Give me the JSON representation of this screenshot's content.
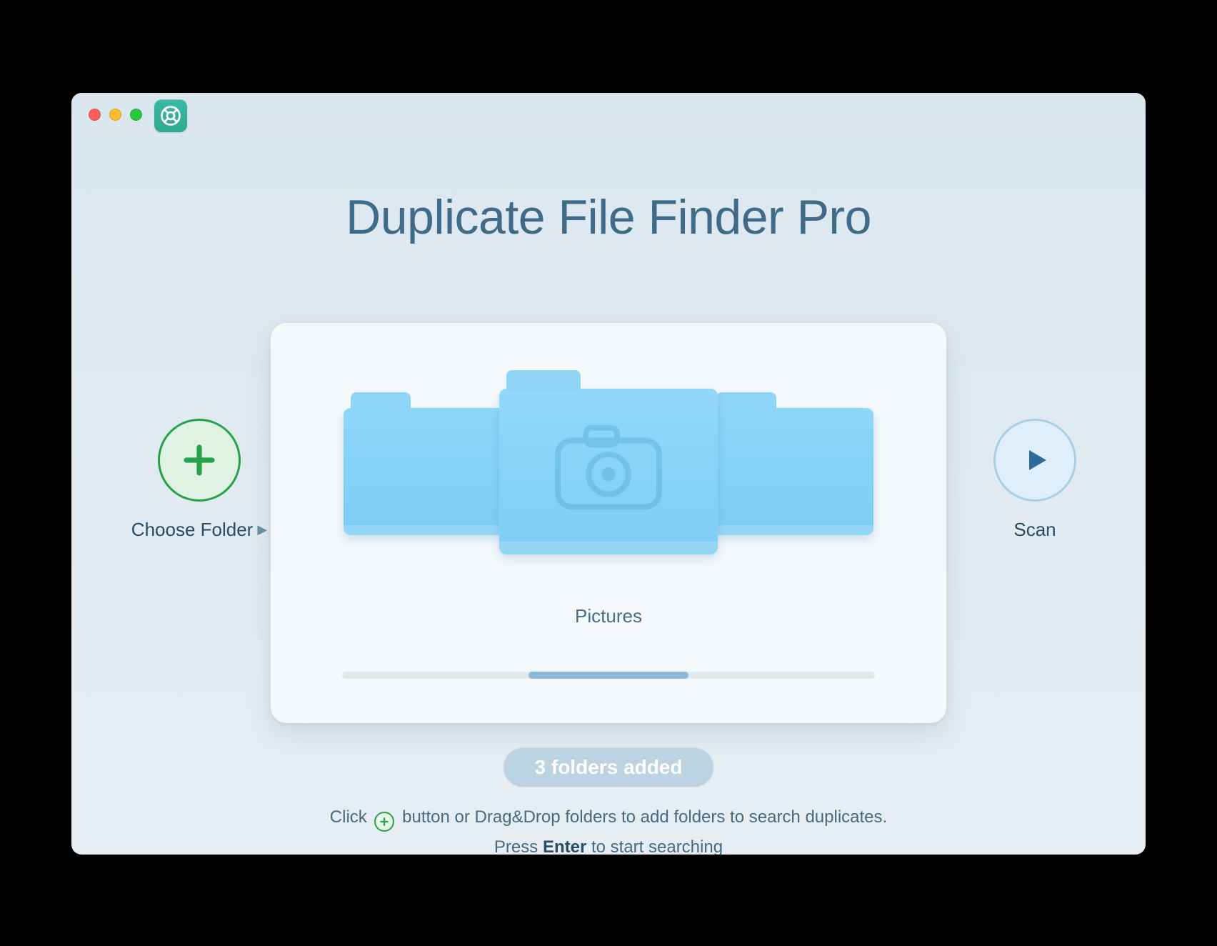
{
  "title": "Duplicate File Finder Pro",
  "choose_button": {
    "label_pre": "Choose Folder",
    "icon": "play-right-icon"
  },
  "scan_button": {
    "label": "Scan"
  },
  "carousel": {
    "selected_label": "Pictures",
    "selected_icon": "camera-icon",
    "scrollbar_thumb_position": 0.35,
    "scrollbar_thumb_width": 0.3
  },
  "chip": "3 folders added",
  "hints": {
    "line1_pre": "Click ",
    "line1_mid": " button or Drag&Drop folders to add folders to search duplicates.",
    "line2_pre": "Press ",
    "line2_bold": "Enter",
    "line2_post": " to start searching"
  }
}
